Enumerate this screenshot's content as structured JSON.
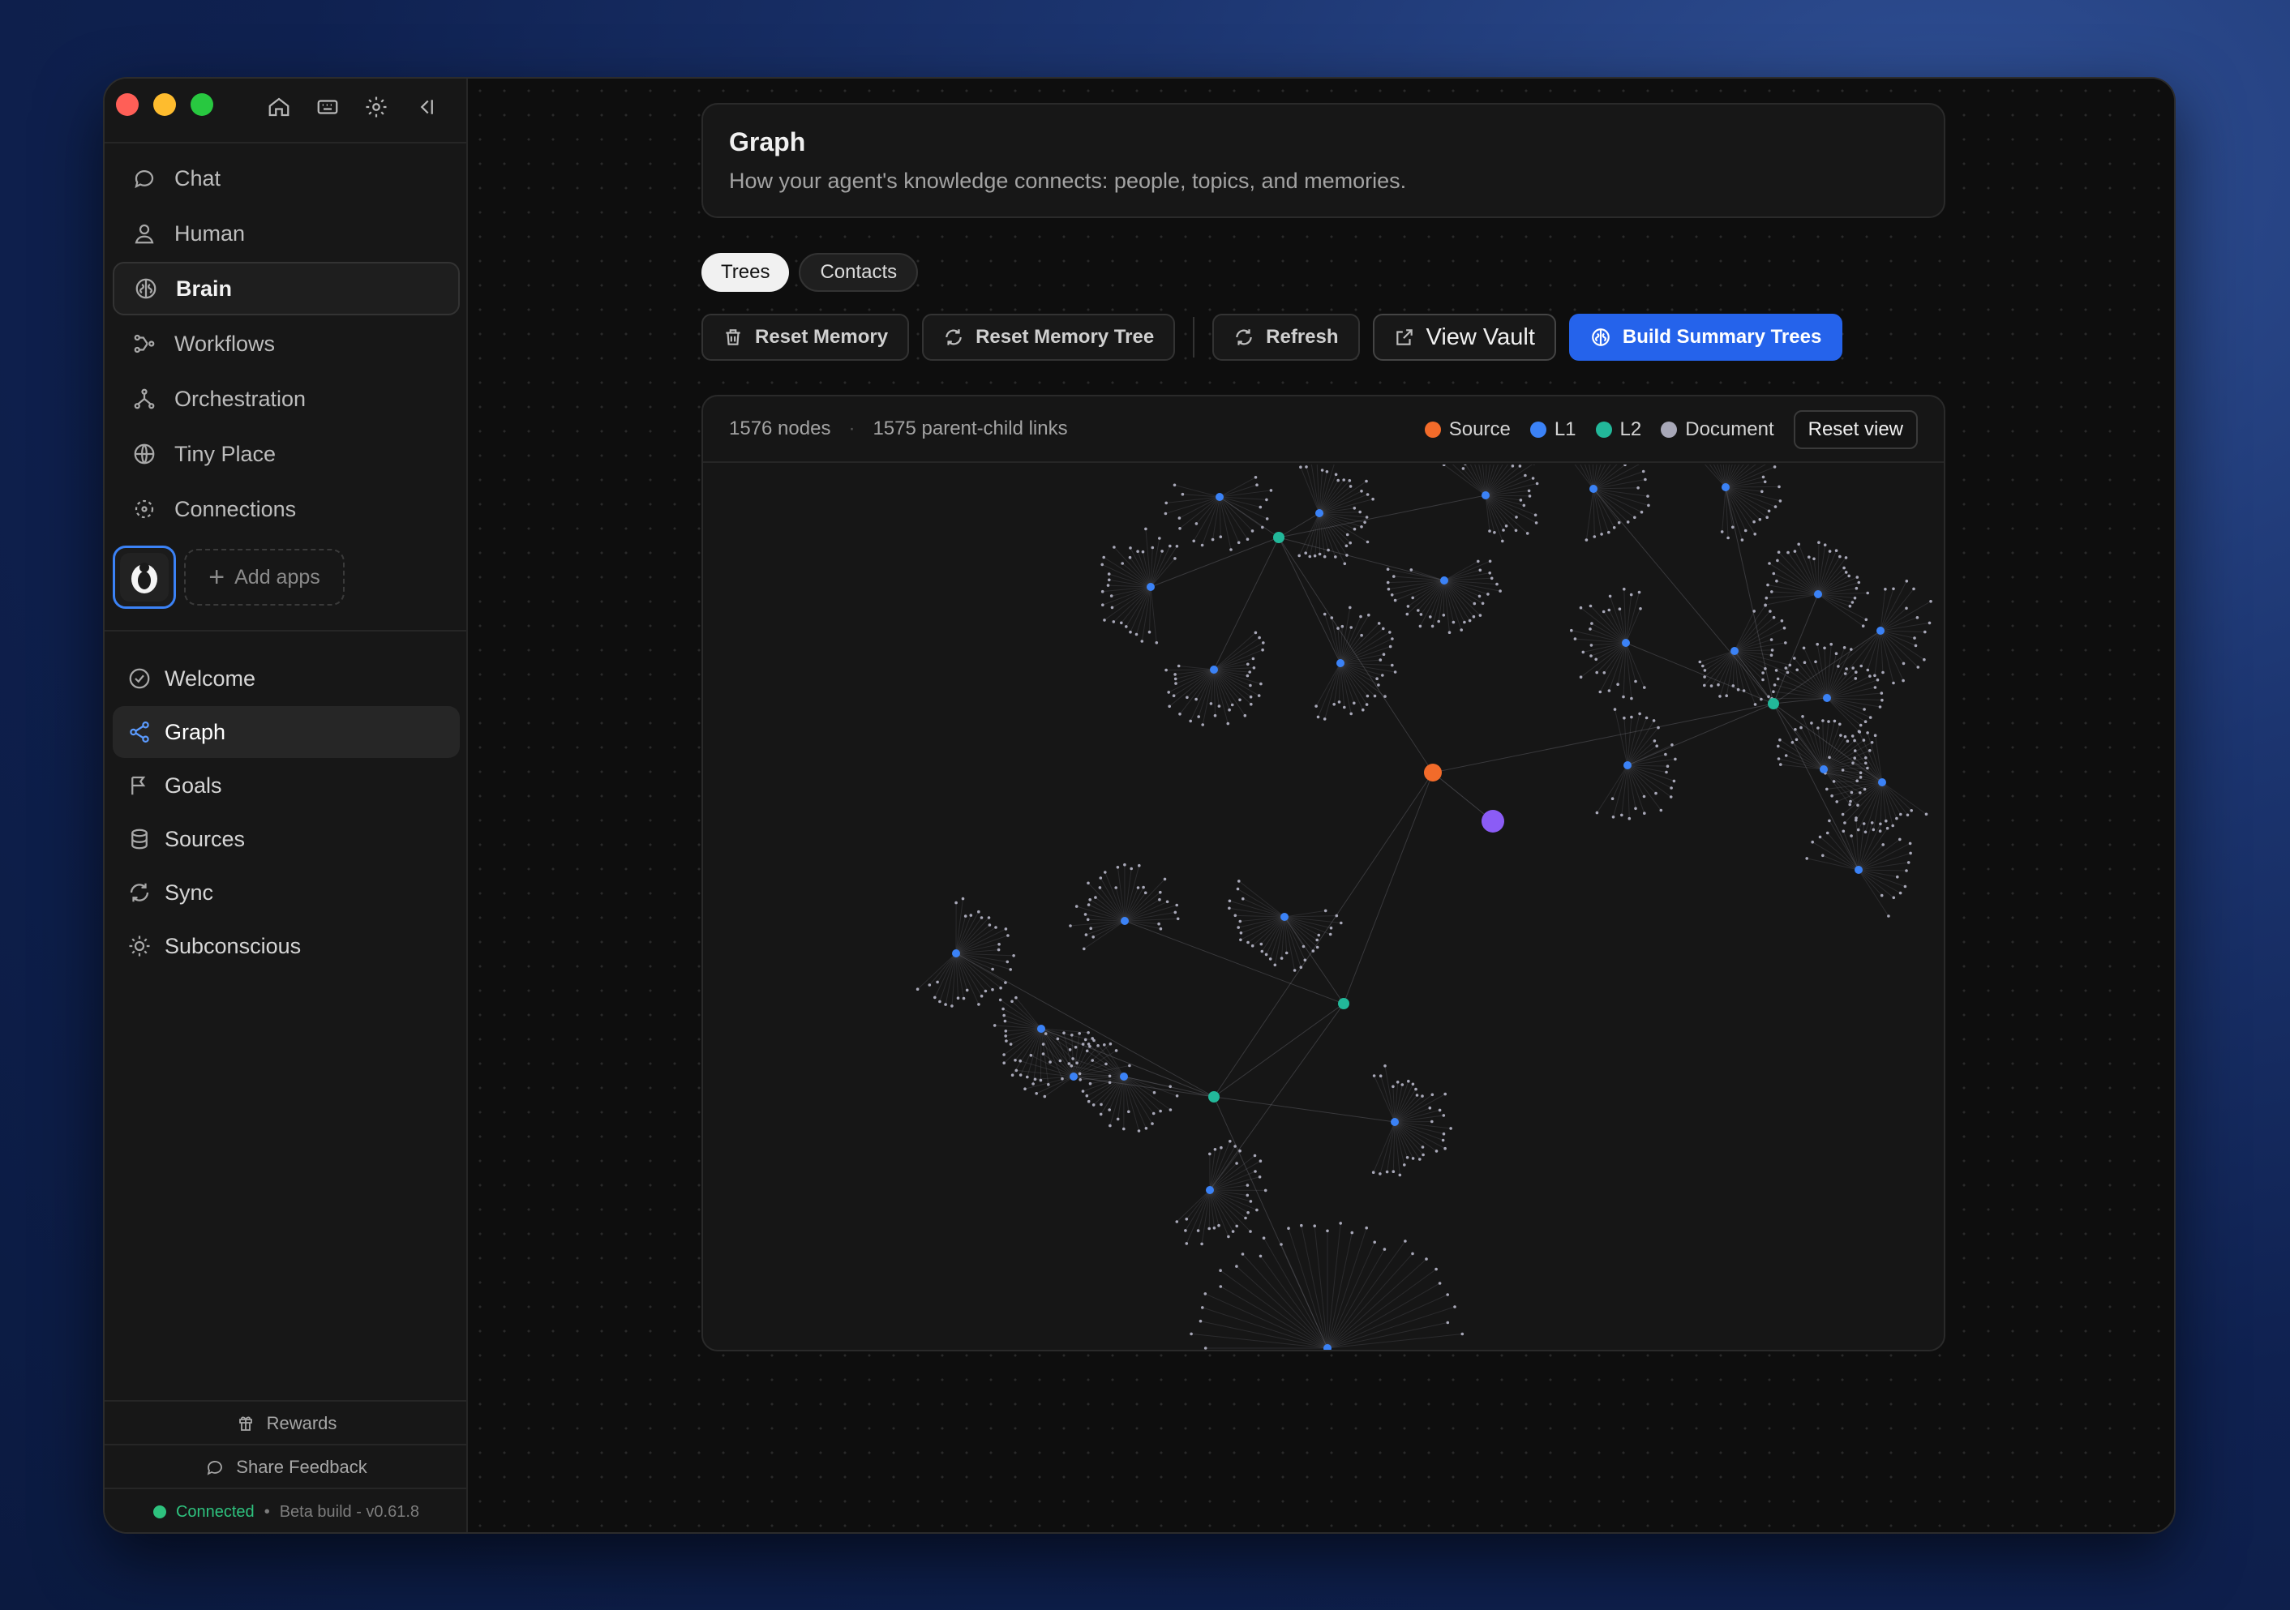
{
  "window": {
    "traffic_lights": [
      "close",
      "minimize",
      "zoom"
    ],
    "top_icons": [
      "home-icon",
      "keyboard-icon",
      "gear-icon",
      "collapse-sidebar-icon"
    ]
  },
  "sidebar": {
    "items": [
      {
        "label": "Chat",
        "icon": "chat-bubble-icon"
      },
      {
        "label": "Human",
        "icon": "user-icon"
      },
      {
        "label": "Brain",
        "icon": "brain-icon",
        "active": true
      },
      {
        "label": "Workflows",
        "icon": "workflow-icon"
      },
      {
        "label": "Orchestration",
        "icon": "orchestration-icon"
      },
      {
        "label": "Tiny Place",
        "icon": "globe-icon"
      },
      {
        "label": "Connections",
        "icon": "connections-icon"
      }
    ],
    "add_apps_label": "Add apps",
    "subnav": [
      {
        "label": "Welcome",
        "icon": "check-circle-icon"
      },
      {
        "label": "Graph",
        "icon": "share-graph-icon",
        "active": true
      },
      {
        "label": "Goals",
        "icon": "flag-icon"
      },
      {
        "label": "Sources",
        "icon": "database-icon"
      },
      {
        "label": "Sync",
        "icon": "sync-icon"
      },
      {
        "label": "Subconscious",
        "icon": "lightbulb-icon"
      }
    ],
    "rewards_label": "Rewards",
    "feedback_label": "Share Feedback",
    "status": {
      "connected": "Connected",
      "separator": "•",
      "build": "Beta build - v0.61.8"
    }
  },
  "header": {
    "title": "Graph",
    "subtitle": "How your agent's knowledge connects: people, topics, and memories."
  },
  "tabs": [
    {
      "label": "Trees",
      "active": true
    },
    {
      "label": "Contacts",
      "active": false
    }
  ],
  "toolbar": {
    "reset_memory": "Reset Memory",
    "reset_memory_tree": "Reset Memory Tree",
    "refresh": "Refresh",
    "view_vault": "View Vault",
    "build_summary_trees": "Build Summary Trees"
  },
  "graph": {
    "nodes_count": "1576 nodes",
    "separator": "·",
    "links_count": "1575 parent-child links",
    "legend": [
      {
        "label": "Source",
        "color": "#f26b2a"
      },
      {
        "label": "L1",
        "color": "#3b82f6"
      },
      {
        "label": "L2",
        "color": "#22b89a"
      },
      {
        "label": "Document",
        "color": "#a8a8b8"
      }
    ],
    "reset_view_label": "Reset view"
  },
  "colors": {
    "accent": "#2563eb",
    "source": "#f26b2a",
    "l1": "#3b82f6",
    "l2": "#22b89a",
    "document": "#a8a8b8",
    "connected": "#2ec27e",
    "highlight": "#8b5cf6"
  }
}
